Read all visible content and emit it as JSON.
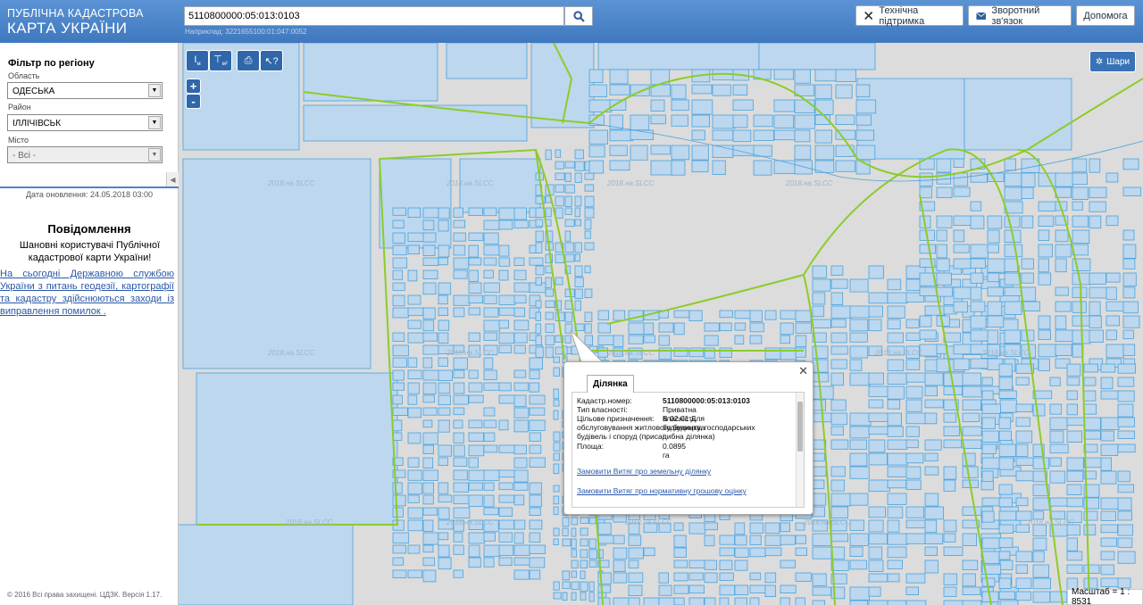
{
  "header": {
    "logo_line1": "ПУБЛІЧНА КАДАСТРОВА",
    "logo_line2": "КАРТА УКРАЇНИ",
    "search_value": "5110800000:05:013:0103",
    "search_example": "Наприклад: 3221655100:01:047:0052",
    "buttons": {
      "support": "Технічна підтримка",
      "feedback": "Зворотний зв'язок",
      "help": "Допомога"
    }
  },
  "sidebar": {
    "filter_title": "Фільтр по регіону",
    "region_label": "Область",
    "region_value": "ОДЕСЬКА",
    "district_label": "Район",
    "district_value": "ІЛЛІЧІВСЬК",
    "city_label": "Місто",
    "city_value": "- Всі -",
    "update_date": "Дата оновлення: 24.05.2018 03:00",
    "notice_title": "Повідомлення",
    "notice_text": "Шановні користувачі Публічної кадастрової карти України!",
    "notice_link": "На сьогодні Державною службою України з питань геодезії, картографії та кадастру здійснюються заходи із виправлення помилок .",
    "copyright": "© 2016 Всі права захищені. ЦДЗК. Версія 1.17."
  },
  "map": {
    "layers_label": "Шари",
    "zoom_in": "+",
    "zoom_out": "-",
    "scale": "Масштаб = 1 : 8531",
    "watermark": "2018.на.SLCC",
    "popup": {
      "tab": "Ділянка",
      "rows": [
        {
          "key": "Кадастр.номер:",
          "value": "5110800000:05:013:0103"
        },
        {
          "key": "Тип власності:",
          "value": "Приватна власність"
        },
        {
          "key": "Цільове призначення:",
          "value": "В 02.01 Для будівництва і"
        },
        {
          "key": "",
          "value": "обслуговування житлового будинку, господарських"
        },
        {
          "key": "",
          "value": "будівель і споруд (присадибна ділянка)"
        },
        {
          "key": "Площа:",
          "value": "0.0895 га"
        }
      ],
      "link1": "Замовити Витяг про земельну ділянку",
      "link2": "Замовити Витяг про нормативну грошову оцінку"
    }
  },
  "colors": {
    "parcel_fill": "#bcd7ee",
    "parcel_stroke": "#4aa2dc",
    "boundary": "#8ccc2a",
    "header": "#4a84c8"
  }
}
